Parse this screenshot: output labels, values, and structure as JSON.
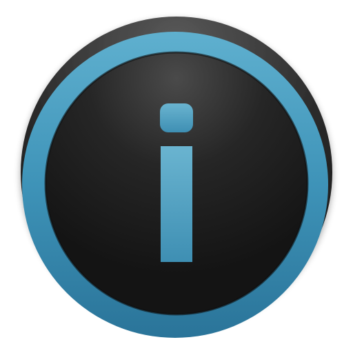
{
  "icon": {
    "name": "info-icon",
    "glyph": "i"
  },
  "colors": {
    "ring_light": "#5fb0cf",
    "ring_mid": "#3e93b8",
    "ring_dark": "#2a7499",
    "face_highlight": "#4a4a4a",
    "face_mid": "#262626",
    "face_dark": "#141414",
    "bezel_top": "#5a5a5a",
    "bezel_dark": "#161616",
    "glyph_light": "#6ab4d0",
    "glyph_dark": "#3e8fb3",
    "background": "#ffffff"
  }
}
